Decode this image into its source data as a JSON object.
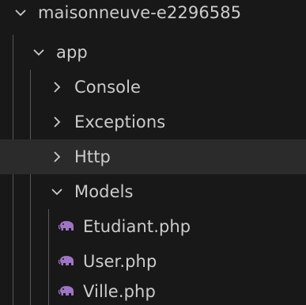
{
  "explorer": {
    "root": {
      "label": "maisonneuve-e2296585",
      "expanded": true,
      "icon": "chevron-down-icon"
    },
    "folders": [
      {
        "label": "app",
        "expanded": true,
        "icon": "chevron-down-icon"
      },
      {
        "label": "Console",
        "expanded": false,
        "icon": "chevron-right-icon"
      },
      {
        "label": "Exceptions",
        "expanded": false,
        "icon": "chevron-right-icon"
      },
      {
        "label": "Http",
        "expanded": false,
        "selected": true,
        "icon": "chevron-right-icon"
      },
      {
        "label": "Models",
        "expanded": true,
        "icon": "chevron-down-icon"
      }
    ],
    "files": [
      {
        "label": "Etudiant.php",
        "icon": "php-elephant-icon"
      },
      {
        "label": "User.php",
        "icon": "php-elephant-icon"
      },
      {
        "label": "Ville.php",
        "icon": "php-elephant-icon"
      }
    ]
  },
  "colors": {
    "background": "#181818",
    "text": "#cccccc",
    "selected_row": "#2b2b2b",
    "indent_guide": "#585858",
    "php_icon": "#a074c4"
  }
}
